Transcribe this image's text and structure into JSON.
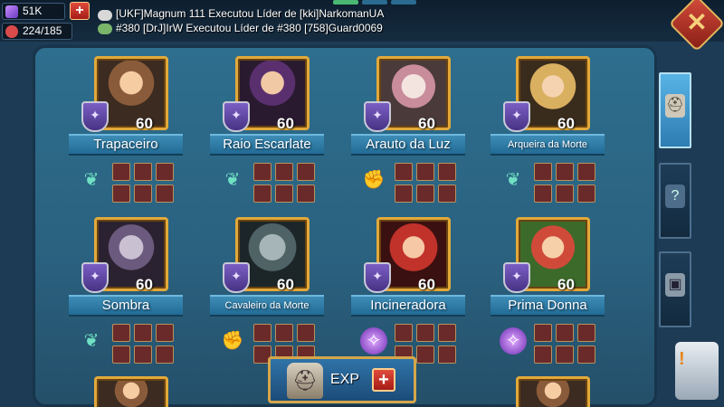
{
  "resources": {
    "gems": "51K",
    "stamina": "224/185"
  },
  "chat": {
    "line1": "[UKF]Magnum 111 Executou Líder de [kki]NarkomanUA",
    "line2": "#380 [DrJ]IrW Executou Líder de #380 [758]Guard0069"
  },
  "close_label": "✕",
  "heroes": [
    {
      "name": "Trapaceiro",
      "level": "60",
      "troop": "ranged",
      "troop_icon": "wing-icon"
    },
    {
      "name": "Raio Escarlate",
      "level": "60",
      "troop": "ranged",
      "troop_icon": "wing-icon"
    },
    {
      "name": "Arauto da Luz",
      "level": "60",
      "troop": "infantry",
      "troop_icon": "fist-icon"
    },
    {
      "name": "Arqueira da Morte",
      "level": "60",
      "troop": "ranged",
      "troop_icon": "wing-icon"
    },
    {
      "name": "Sombra",
      "level": "60",
      "troop": "ranged",
      "troop_icon": "wing-icon"
    },
    {
      "name": "Cavaleiro da Morte",
      "level": "60",
      "troop": "infantry",
      "troop_icon": "fist-icon"
    },
    {
      "name": "Incineradora",
      "level": "60",
      "troop": "magic",
      "troop_icon": "magic-orb-icon"
    },
    {
      "name": "Prima Donna",
      "level": "60",
      "troop": "magic",
      "troop_icon": "magic-orb-icon"
    }
  ],
  "tabs": [
    {
      "name": "heroes-tab",
      "icon": "helmet-icon",
      "active": true
    },
    {
      "name": "skills-tab",
      "icon": "question-shield-icon",
      "active": false
    },
    {
      "name": "chest-tab",
      "icon": "chest-icon",
      "active": false
    }
  ],
  "exp_button": {
    "label": "EXP",
    "plus": "+"
  },
  "colors": {
    "panel": "#2a617f",
    "frame_gold": "#e2a93a",
    "ribbon": "#2f7fac",
    "add_red": "#c22a21"
  }
}
